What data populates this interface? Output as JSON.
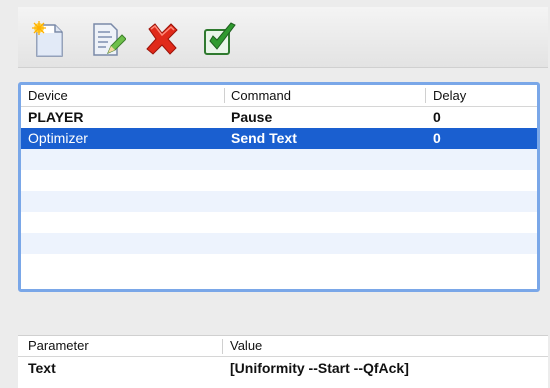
{
  "toolbar": {
    "buttons": [
      {
        "name": "new-icon"
      },
      {
        "name": "edit-icon"
      },
      {
        "name": "delete-icon"
      },
      {
        "name": "accept-icon"
      }
    ],
    "colors": {
      "delete": "#e02a1a",
      "accept": "#2f9a2f"
    }
  },
  "commands": {
    "headers": {
      "device": "Device",
      "command": "Command",
      "delay": "Delay"
    },
    "rows": [
      {
        "device": "PLAYER",
        "command": "Pause",
        "delay": "0",
        "selected": false
      },
      {
        "device": "Optimizer",
        "command": "Send Text",
        "delay": "0",
        "selected": true
      }
    ],
    "selection_color": "#1a5fd0"
  },
  "parameters": {
    "headers": {
      "parameter": "Parameter",
      "value": "Value"
    },
    "rows": [
      {
        "parameter": "Text",
        "value": "[Uniformity --Start --QfAck]"
      }
    ]
  }
}
